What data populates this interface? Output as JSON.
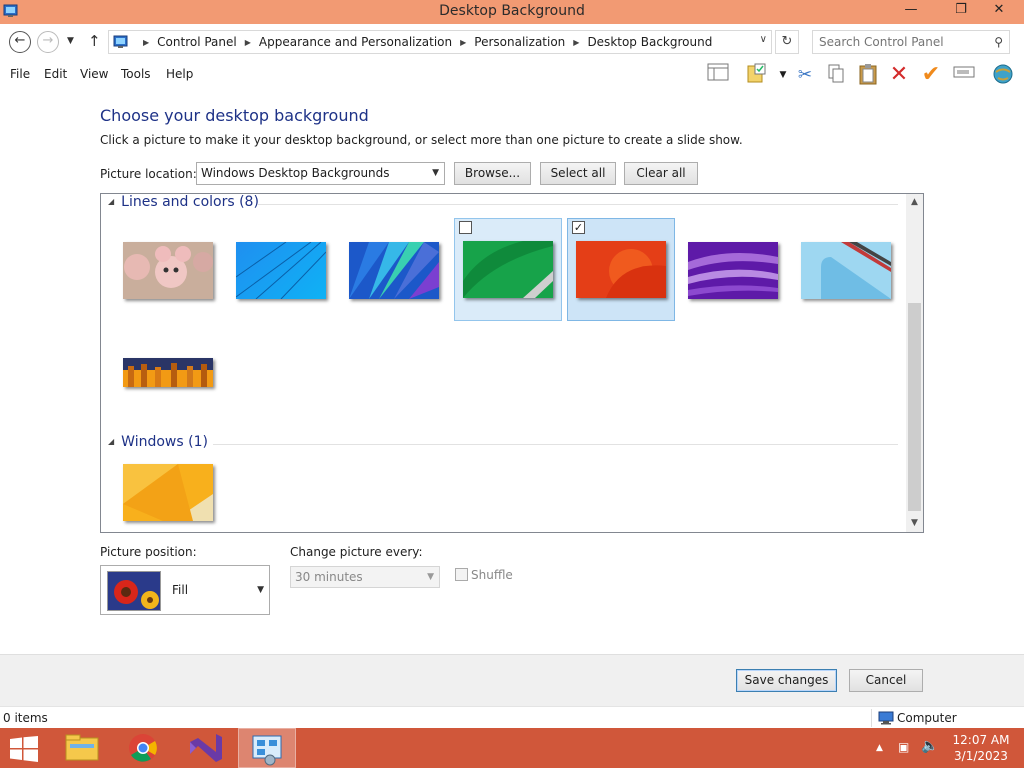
{
  "window": {
    "title": "Desktop Background",
    "minimize_icon": "minimize-icon",
    "restore_icon": "restore-icon",
    "close_icon": "close-icon"
  },
  "address": {
    "crumbs": [
      "Control Panel",
      "Appearance and Personalization",
      "Personalization",
      "Desktop Background"
    ],
    "search_placeholder": "Search Control Panel"
  },
  "menu": [
    "File",
    "Edit",
    "View",
    "Tools",
    "Help"
  ],
  "toolbar_icons": [
    "layout-pane-icon",
    "properties-icon",
    "cut-icon",
    "copy-icon",
    "paste-icon",
    "delete-icon",
    "checkmark-icon",
    "rename-icon",
    "network-globe-icon"
  ],
  "main": {
    "heading": "Choose your desktop background",
    "subtitle": "Click a picture to make it your desktop background, or select more than one picture to create a slide show.",
    "location_label": "Picture location:",
    "location_value": "Windows Desktop Backgrounds",
    "browse": "Browse...",
    "select_all": "Select all",
    "clear_all": "Clear all"
  },
  "groups": [
    {
      "title": "Lines and colors (8)",
      "items": [
        {
          "name": "pink-cartoon",
          "checked": null
        },
        {
          "name": "blue-lines",
          "checked": null
        },
        {
          "name": "blue-fan",
          "checked": null
        },
        {
          "name": "green-wave",
          "checked": false
        },
        {
          "name": "red-orange",
          "checked": true
        },
        {
          "name": "purple-ribbons",
          "checked": null
        },
        {
          "name": "light-blue-stripes",
          "checked": null
        },
        {
          "name": "orange-panels",
          "checked": null
        }
      ]
    },
    {
      "title": "Windows (1)",
      "items": [
        {
          "name": "windows-yellow",
          "checked": null
        }
      ]
    }
  ],
  "position": {
    "label": "Picture position:",
    "value": "Fill"
  },
  "slideshow": {
    "label": "Change picture every:",
    "value": "30 minutes",
    "shuffle": "Shuffle"
  },
  "footer": {
    "save": "Save changes",
    "cancel": "Cancel"
  },
  "status": {
    "items": "0 items",
    "computer": "Computer"
  },
  "taskbar": {
    "apps": [
      "file-explorer-icon",
      "chrome-icon",
      "visual-studio-icon",
      "control-panel-icon"
    ],
    "time": "12:07 AM",
    "date": "3/1/2023"
  }
}
